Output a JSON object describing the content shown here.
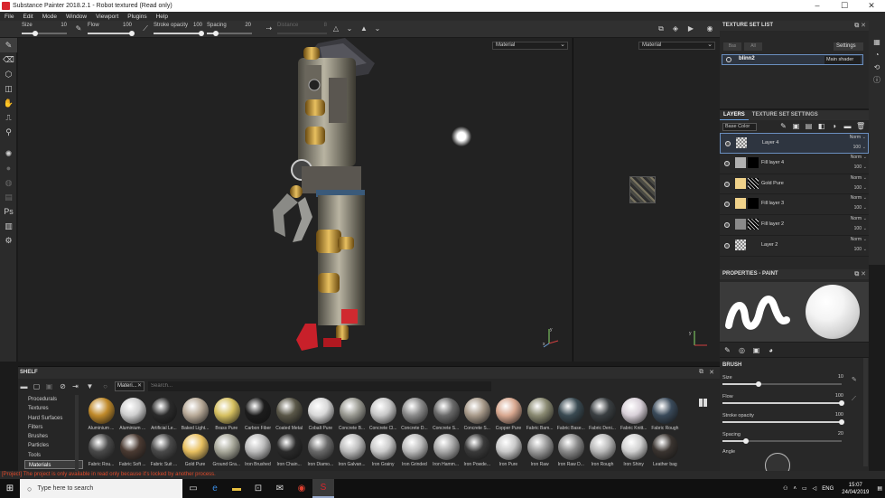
{
  "window": {
    "title": "Substance Painter 2018.2.1 - Robot textured (Read only)"
  },
  "menu": [
    "File",
    "Edit",
    "Mode",
    "Window",
    "Viewport",
    "Plugins",
    "Help"
  ],
  "tool_options": {
    "size_label": "Size",
    "size_value": "10",
    "flow_label": "Flow",
    "flow_value": "100",
    "stroke_opacity_label": "Stroke opacity",
    "stroke_opacity_value": "100",
    "spacing_label": "Spacing",
    "spacing_value": "20",
    "distance_label": "Distance",
    "distance_value": "8"
  },
  "viewport": {
    "mode_3d": "Material",
    "mode_2d": "Material"
  },
  "texture_set_list": {
    "title": "TEXTURE SET LIST",
    "settings_label": "Settings",
    "btn_a": "Bas",
    "btn_b": "All",
    "set_name": "blinn2",
    "shader": "Main shader"
  },
  "layers_panel": {
    "tab_layers": "LAYERS",
    "tab_settings": "TEXTURE SET SETTINGS",
    "channel": "Base Color",
    "layers": [
      {
        "name": "Layer 4",
        "blend": "Norm",
        "opacity": "100",
        "thumb": "checker",
        "mask": "",
        "selected": true
      },
      {
        "name": "Fill layer 4",
        "blend": "Norm",
        "opacity": "100",
        "thumb": "#b0b0b0",
        "mask": "black",
        "selected": false
      },
      {
        "name": "Gold Pure",
        "blend": "Norm",
        "opacity": "100",
        "thumb": "#f0d28a",
        "mask": "pattern",
        "selected": false
      },
      {
        "name": "Fill layer 3",
        "blend": "Norm",
        "opacity": "100",
        "thumb": "#f0d28a",
        "mask": "black",
        "selected": false
      },
      {
        "name": "Fill layer 2",
        "blend": "Norm",
        "opacity": "100",
        "thumb": "#8a8a8a",
        "mask": "pattern",
        "selected": false
      },
      {
        "name": "Layer 2",
        "blend": "Norm",
        "opacity": "100",
        "thumb": "checker",
        "mask": "",
        "selected": false
      }
    ]
  },
  "properties": {
    "title": "PROPERTIES - PAINT",
    "brush_title": "BRUSH",
    "size_label": "Size",
    "size_value": "10",
    "size_fraction": 0.3,
    "flow_label": "Flow",
    "flow_value": "100",
    "flow_fraction": 1.0,
    "stroke_opacity_label": "Stroke opacity",
    "stroke_opacity_value": "100",
    "stroke_opacity_fraction": 1.0,
    "spacing_label": "Spacing",
    "spacing_value": "20",
    "spacing_fraction": 0.2,
    "angle_label": "Angle"
  },
  "shelf": {
    "title": "SHELF",
    "filter_tag": "Materi...",
    "search_placeholder": "Search...",
    "categories": [
      "Procedurals",
      "Textures",
      "Hard Surfaces",
      "Filters",
      "Brushes",
      "Particles",
      "Tools",
      "Materials"
    ],
    "active_category": "Materials",
    "materials": [
      {
        "name": "Aluminium ...",
        "color": "#c08a2a"
      },
      {
        "name": "Aluminium ...",
        "color": "#cfcfcf"
      },
      {
        "name": "Artificial Le...",
        "color": "#2a2a2a"
      },
      {
        "name": "Baked Light...",
        "color": "#b8aa98"
      },
      {
        "name": "Brass Pure",
        "color": "#d6c060"
      },
      {
        "name": "Carbon Fiber",
        "color": "#1c1c1c"
      },
      {
        "name": "Coated Metal",
        "color": "#5a5748"
      },
      {
        "name": "Cobalt Pure",
        "color": "#d8d8d8"
      },
      {
        "name": "Concrete B...",
        "color": "#9a9a92"
      },
      {
        "name": "Concrete Cl...",
        "color": "#c8c8c8"
      },
      {
        "name": "Concrete D...",
        "color": "#8a8a8a"
      },
      {
        "name": "Concrete S...",
        "color": "#6a6a6a"
      },
      {
        "name": "Concrete S...",
        "color": "#a89a8a"
      },
      {
        "name": "Copper Pure",
        "color": "#d8a890"
      },
      {
        "name": "Fabric Bam...",
        "color": "#8a8a72"
      },
      {
        "name": "Fabric Base...",
        "color": "#3a4a52"
      },
      {
        "name": "Fabric Deni...",
        "color": "#3a3f42"
      },
      {
        "name": "Fabric Knitt...",
        "color": "#d8d0d8"
      },
      {
        "name": "Fabric Rough",
        "color": "#3a4a5a"
      },
      {
        "name": "Fabric Rou...",
        "color": "#4a4a4a"
      },
      {
        "name": "Fabric Soft ...",
        "color": "#4a3a32"
      },
      {
        "name": "Fabric Suit ...",
        "color": "#4a4a4a"
      },
      {
        "name": "Gold Pure",
        "color": "#e8c060"
      },
      {
        "name": "Ground Gra...",
        "color": "#a8a89a"
      },
      {
        "name": "Iron Brushed",
        "color": "#bcbcbc"
      },
      {
        "name": "Iron Chain...",
        "color": "#2a2a2a"
      },
      {
        "name": "Iron Diamo...",
        "color": "#6a6a6a"
      },
      {
        "name": "Iron Galvan...",
        "color": "#bcbcbc"
      },
      {
        "name": "Iron Grainy",
        "color": "#cacaca"
      },
      {
        "name": "Iron Grinded",
        "color": "#bcbcbc"
      },
      {
        "name": "Iron Hamm...",
        "color": "#a8a8a8"
      },
      {
        "name": "Iron Powde...",
        "color": "#3a3a3a"
      },
      {
        "name": "Iron Pure",
        "color": "#cacaca"
      },
      {
        "name": "Iron Raw",
        "color": "#9a9a9a"
      },
      {
        "name": "Iron Raw D...",
        "color": "#8a8a8a"
      },
      {
        "name": "Iron Rough",
        "color": "#b8b8b8"
      },
      {
        "name": "Iron Shiny",
        "color": "#d0d0d0"
      },
      {
        "name": "Leather bag",
        "color": "#3a3430"
      }
    ]
  },
  "status": {
    "message": "[Project] The project is only available in read only because it's locked by another process."
  },
  "taskbar": {
    "search_placeholder": "Type here to search",
    "language": "ENG",
    "time": "15:07",
    "date": "24/04/2019"
  },
  "colors": {
    "accent": "#6a8fc0",
    "status_error": "#e04a2a",
    "app_icon": "#d8262e"
  }
}
